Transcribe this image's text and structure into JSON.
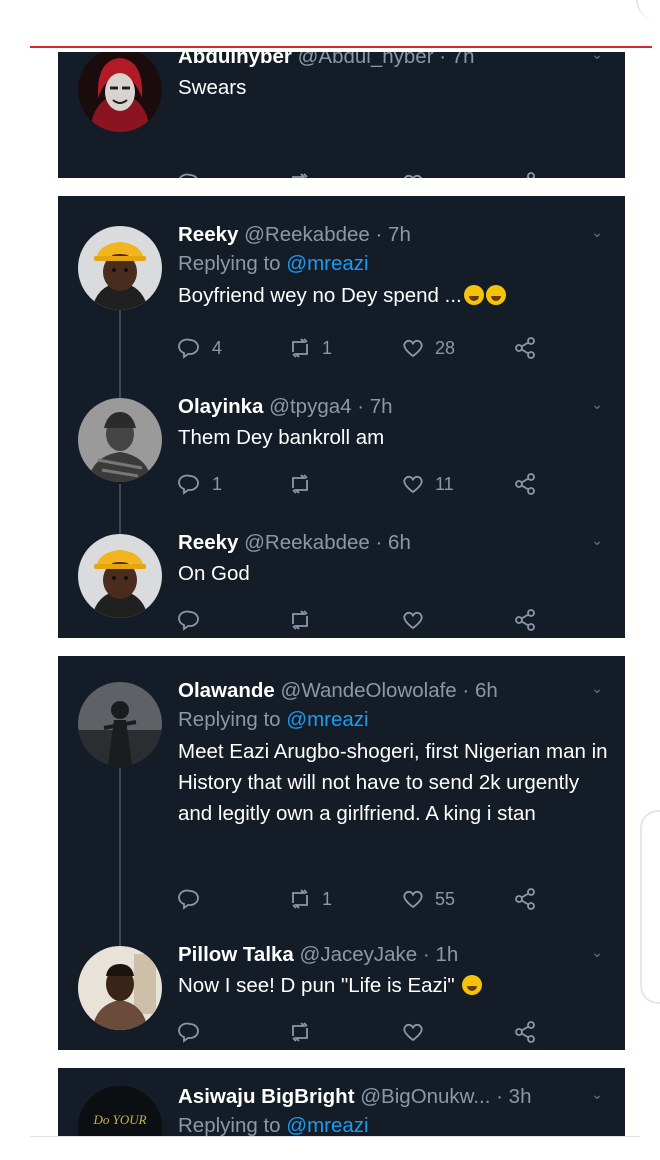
{
  "colors": {
    "card_bg": "#141c27",
    "text_primary": "#ffffff",
    "text_secondary": "#8b98a6",
    "mention": "#1d9bf0",
    "accent_line": "#d8282e"
  },
  "cards": [
    {
      "tweets": [
        {
          "name": "Abdulhyber",
          "handle": "@Abdul_hyber",
          "time": "· 7h",
          "reply_prefix": "",
          "reply_to": "",
          "text": "Swears",
          "emoji": "",
          "replies": "",
          "retweets": "",
          "likes": "",
          "avatar": "hooded-mask-avatar"
        }
      ]
    },
    {
      "tweets": [
        {
          "name": "Reeky",
          "handle": "@Reekabdee",
          "time": "· 7h",
          "reply_prefix": "Replying to ",
          "reply_to": "@mreazi",
          "text": "Boyfriend wey no Dey spend ...",
          "emoji": "rofl rofl",
          "replies": "4",
          "retweets": "1",
          "likes": "28",
          "avatar": "yellow-hat-avatar"
        },
        {
          "name": "Olayinka",
          "handle": "@tpyga4",
          "time": "· 7h",
          "reply_prefix": "",
          "reply_to": "",
          "text": "Them Dey bankroll am",
          "emoji": "",
          "replies": "1",
          "retweets": "",
          "likes": "11",
          "avatar": "grayscale-avatar"
        },
        {
          "name": "Reeky",
          "handle": "@Reekabdee",
          "time": "· 6h",
          "reply_prefix": "",
          "reply_to": "",
          "text": "On God",
          "emoji": "",
          "replies": "",
          "retweets": "",
          "likes": "",
          "avatar": "yellow-hat-avatar"
        }
      ]
    },
    {
      "tweets": [
        {
          "name": "Olawande",
          "handle": "@WandeOlowolafe",
          "time": "· 6h",
          "reply_prefix": "Replying to ",
          "reply_to": "@mreazi",
          "text": "Meet Eazi Arugbo-shogeri, first Nigerian man in History that will not have to send 2k urgently and legitly own a girlfriend. A king i stan",
          "emoji": "",
          "replies": "",
          "retweets": "1",
          "likes": "55",
          "avatar": "dark-figure-avatar"
        },
        {
          "name": "Pillow Talka",
          "handle": "@JaceyJake",
          "time": "· 1h",
          "reply_prefix": "",
          "reply_to": "",
          "text": "Now I see! D pun \"Life is Eazi\"",
          "emoji": "joy",
          "replies": "",
          "retweets": "",
          "likes": "",
          "avatar": "portrait-avatar"
        }
      ]
    },
    {
      "tweets": [
        {
          "name": "Asiwaju BigBright",
          "handle": "@BigOnukw...",
          "time": "· 3h",
          "reply_prefix": "Replying to ",
          "reply_to": "@mreazi",
          "text": "",
          "emoji": "",
          "replies": "",
          "retweets": "",
          "likes": "",
          "avatar_text": "Do YOUR"
        }
      ]
    }
  ]
}
